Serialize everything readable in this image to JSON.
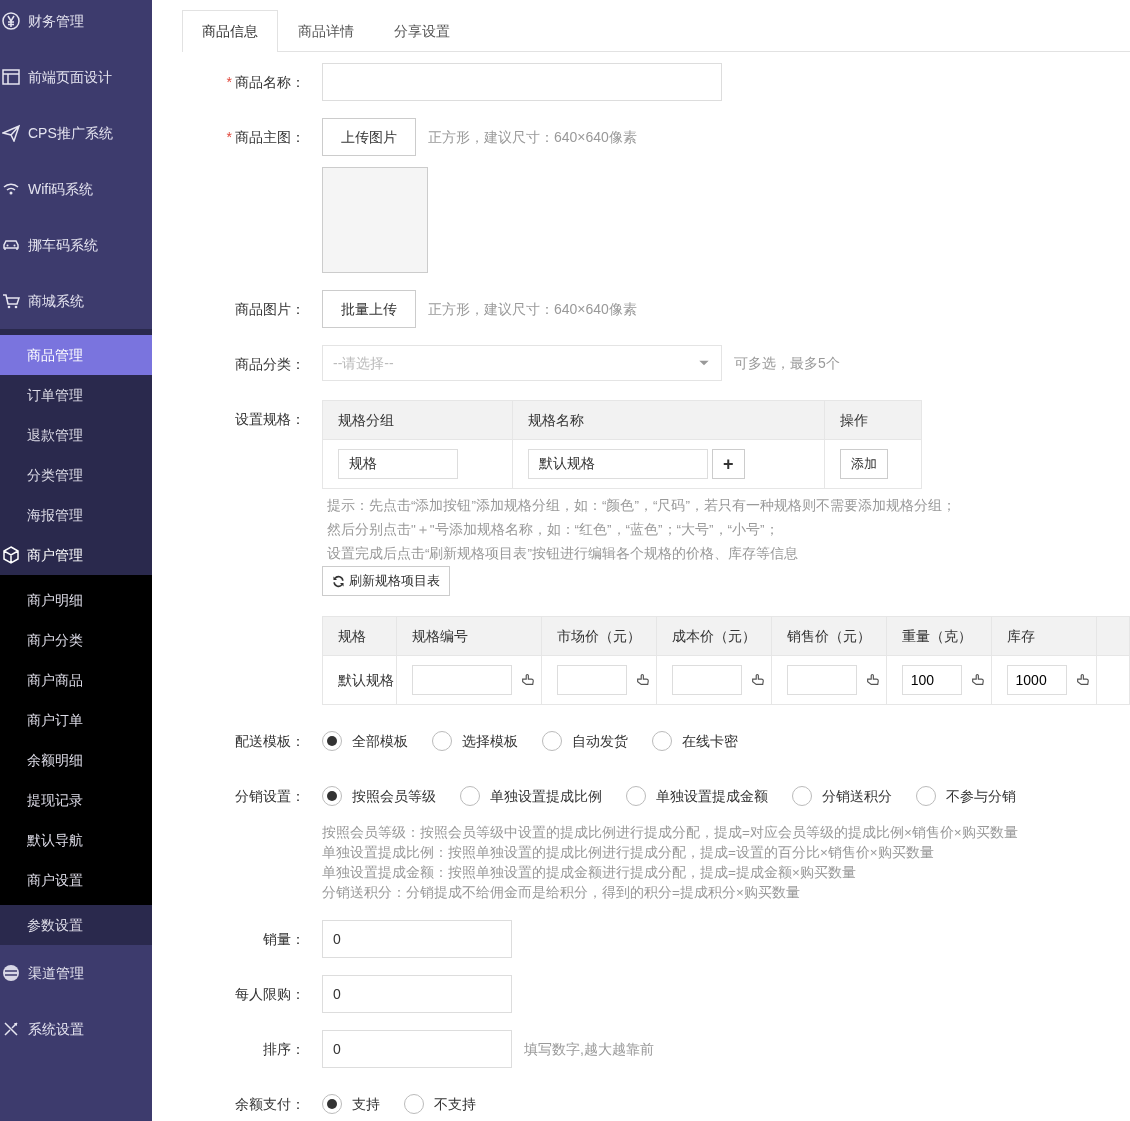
{
  "sidebar": {
    "items": [
      {
        "label": "财务管理",
        "selected": false
      },
      {
        "label": "前端页面设计",
        "selected": false
      },
      {
        "label": "CPS推广系统",
        "selected": false
      },
      {
        "label": "Wifi码系统",
        "selected": false
      },
      {
        "label": "挪车码系统",
        "selected": false
      },
      {
        "label": "商城系统",
        "selected": false,
        "children": [
          {
            "label": "商品管理",
            "selected": true
          },
          {
            "label": "订单管理",
            "selected": false
          },
          {
            "label": "退款管理",
            "selected": false
          },
          {
            "label": "分类管理",
            "selected": false
          },
          {
            "label": "海报管理",
            "selected": false
          },
          {
            "label": "商户管理",
            "selected": false,
            "children": [
              {
                "label": "商户明细",
                "selected": false
              },
              {
                "label": "商户分类",
                "selected": false
              },
              {
                "label": "商户商品",
                "selected": false
              },
              {
                "label": "商户订单",
                "selected": false
              },
              {
                "label": "余额明细",
                "selected": false
              },
              {
                "label": "提现记录",
                "selected": false
              },
              {
                "label": "默认导航",
                "selected": false
              },
              {
                "label": "商户设置",
                "selected": false
              }
            ]
          },
          {
            "label": "参数设置",
            "selected": false
          }
        ]
      },
      {
        "label": "渠道管理",
        "selected": false
      },
      {
        "label": "系统设置",
        "selected": false
      }
    ]
  },
  "tabs": [
    {
      "label": "商品信息",
      "selected": true
    },
    {
      "label": "商品详情",
      "selected": false
    },
    {
      "label": "分享设置",
      "selected": false
    }
  ],
  "form": [
    {
      "kind": "text",
      "mark": "*",
      "label": "商品名称："
    },
    {
      "kind": "upload",
      "mark": "*",
      "label": "商品主图：",
      "button": "上传图片",
      "hint": "正方形，建议尺寸：640×640像素",
      "preview": true
    },
    {
      "kind": "upload",
      "label": "商品图片：",
      "button": "批量上传",
      "hint": "正方形，建议尺寸：640×640像素"
    },
    {
      "kind": "select",
      "label": "商品分类：",
      "placeholder": "--请选择--",
      "hint": "可多选，最多5个"
    },
    {
      "kind": "spec",
      "label": "设置规格：",
      "columns": [
        "规格分组",
        "规格名称",
        "操作"
      ],
      "group_value": "规格",
      "name_value": "默认规格",
      "plus_button": "+",
      "add_button": "添加",
      "tips": [
        "提示：先点击“添加按钮”添加规格分组，如：“颜色”，“尺码”，若只有一种规格则不需要添加规格分组；",
        "然后分别点击\"＋\"号添加规格名称，如：“红色”，“蓝色”；“大号”，“小号”；",
        "设置完成后点击“刷新规格项目表”按钮进行编辑各个规格的价格、库存等信息"
      ],
      "refresh_button": "刷新规格项目表",
      "sku_columns": [
        "规格",
        "规格编号",
        "市场价（元）",
        "成本价（元）",
        "销售价（元）",
        "重量（克）",
        "库存"
      ],
      "sku_rows": [
        {
          "spec": "默认规格",
          "cells": [
            null,
            null,
            null,
            null,
            "100",
            "1000"
          ]
        }
      ]
    },
    {
      "kind": "radio",
      "label": "配送模板：",
      "options": [
        {
          "label": "全部模板",
          "selected": true
        },
        {
          "label": "选择模板",
          "selected": false
        },
        {
          "label": "自动发货",
          "selected": false
        },
        {
          "label": "在线卡密",
          "selected": false
        }
      ]
    },
    {
      "kind": "radio",
      "label": "分销设置：",
      "options": [
        {
          "label": "按照会员等级",
          "selected": true
        },
        {
          "label": "单独设置提成比例",
          "selected": false
        },
        {
          "label": "单独设置提成金额",
          "selected": false
        },
        {
          "label": "分销送积分",
          "selected": false
        },
        {
          "label": "不参与分销",
          "selected": false
        }
      ],
      "notes": [
        "按照会员等级：按照会员等级中设置的提成比例进行提成分配，提成=对应会员等级的提成比例×销售价×购买数量",
        "单独设置提成比例：按照单独设置的提成比例进行提成分配，提成=设置的百分比×销售价×购买数量",
        "单独设置提成金额：按照单独设置的提成金额进行提成分配，提成=提成金额×购买数量",
        "分销送积分：分销提成不给佣金而是给积分，得到的积分=提成积分×购买数量"
      ]
    },
    {
      "kind": "number",
      "label": "销量：",
      "value": "0"
    },
    {
      "kind": "number",
      "label": "每人限购：",
      "value": "0"
    },
    {
      "kind": "number",
      "label": "排序：",
      "value": "0",
      "hint": "填写数字,越大越靠前"
    },
    {
      "kind": "radio",
      "label": "余额支付：",
      "options": [
        {
          "label": "支持",
          "selected": true
        },
        {
          "label": "不支持",
          "selected": false
        }
      ]
    }
  ]
}
